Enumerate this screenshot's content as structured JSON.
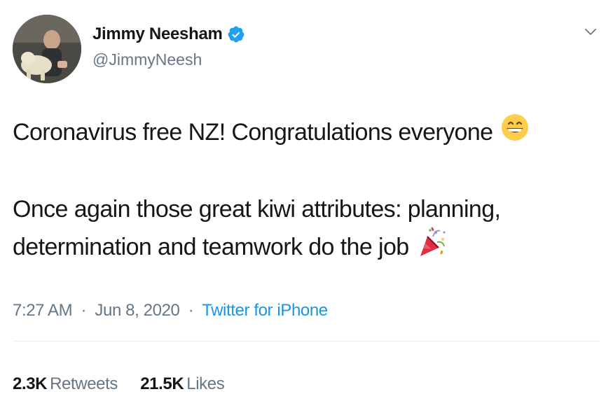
{
  "author": {
    "display_name": "Jimmy Neesham",
    "handle": "@JimmyNeesh",
    "verified": true
  },
  "tweet": {
    "line1": "Coronavirus free NZ! Congratulations everyone",
    "line1_emoji": "grinning-face-icon",
    "line2": "Once again those great kiwi attributes: planning,",
    "line3": "determination and teamwork do the job",
    "line3_emoji": "party-popper-icon"
  },
  "meta": {
    "time": "7:27 AM",
    "separator": "·",
    "date": "Jun 8, 2020",
    "source": "Twitter for iPhone"
  },
  "stats": {
    "retweets_count": "2.3K",
    "retweets_label": "Retweets",
    "likes_count": "21.5K",
    "likes_label": "Likes"
  },
  "colors": {
    "text": "#14171a",
    "secondary": "#657786",
    "link": "#1b95e0",
    "verified": "#1da1f2",
    "divider": "#e6ecf0"
  }
}
